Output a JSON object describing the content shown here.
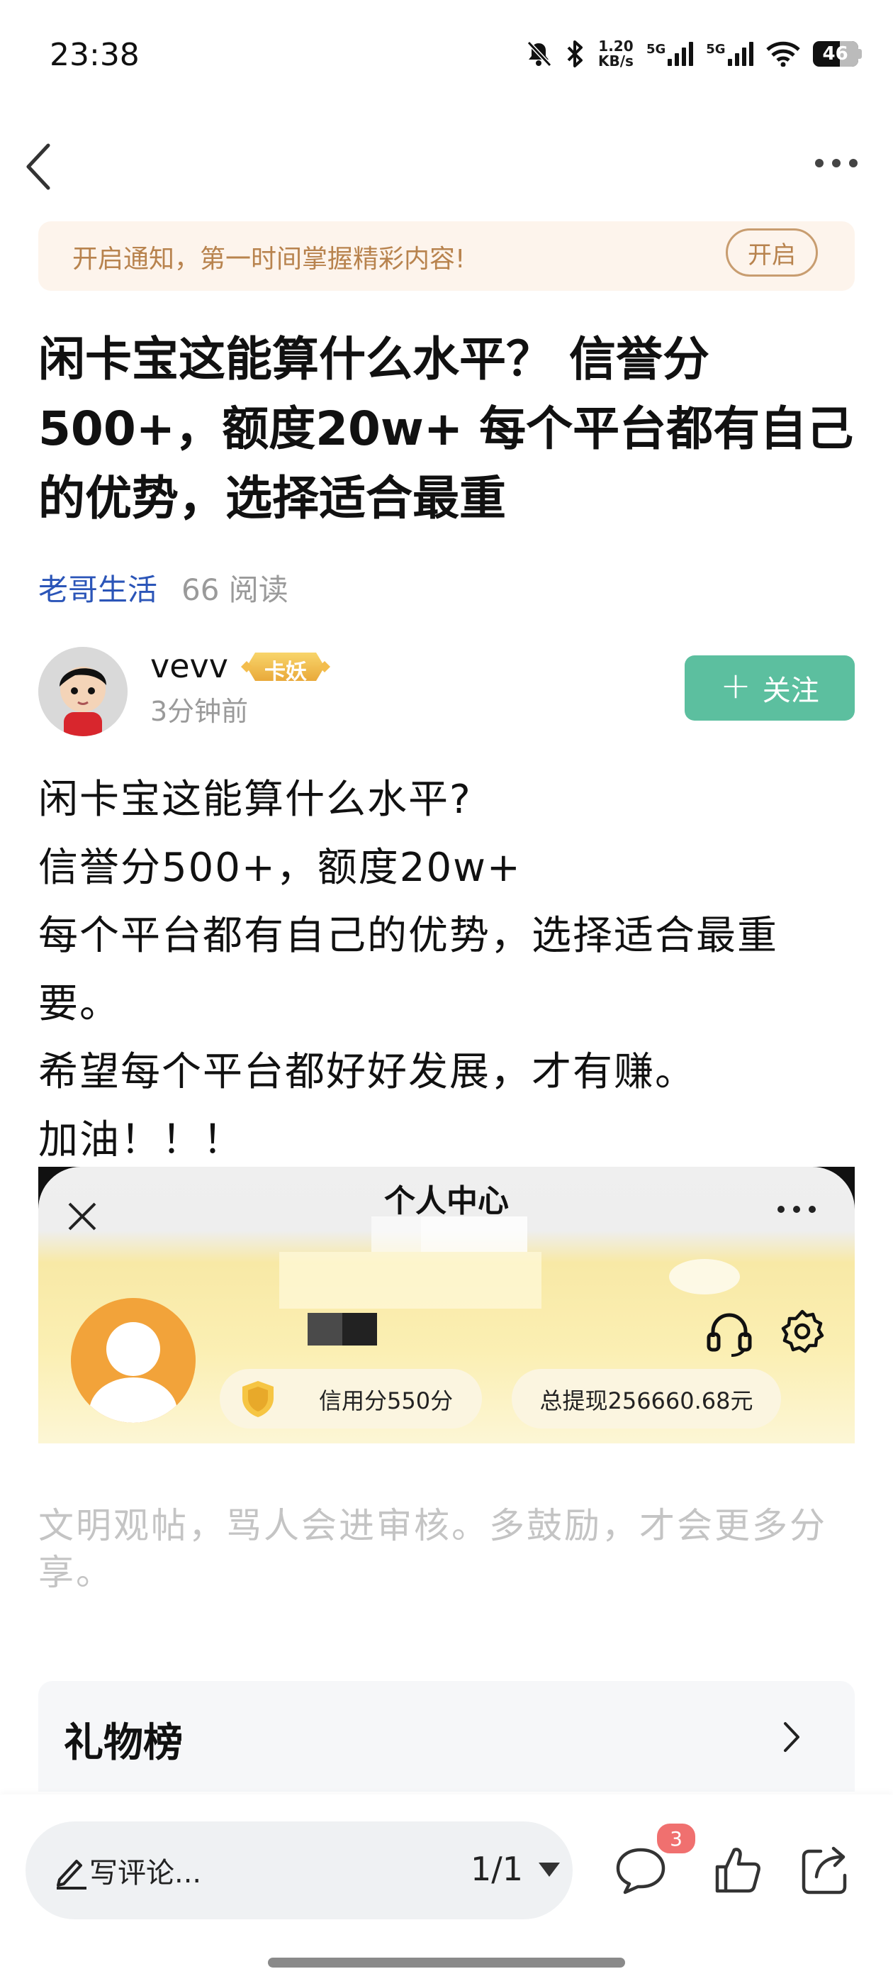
{
  "status_bar": {
    "time": "23:38",
    "net_speed_value": "1.20",
    "net_speed_unit": "KB/s",
    "sim1": "5G",
    "sim2": "5G",
    "battery": "46"
  },
  "nav": {
    "back_icon": "chevron-left-icon",
    "more_icon": "more-icon"
  },
  "notify": {
    "text": "开启通知，第一时间掌握精彩内容!",
    "button": "开启"
  },
  "post": {
    "title": "闲卡宝这能算什么水平？ 信誉分500+，额度20w+ 每个平台都有自己的优势，选择适合最重",
    "circle": "老哥生活",
    "reads": "66 阅读",
    "author": "vevv",
    "badge": "卡妖",
    "time": "3分钟前",
    "follow": "关注",
    "body": [
      "闲卡宝这能算什么水平?",
      "信誉分500+，额度20w+",
      "每个平台都有自己的优势，选择适合最重",
      "要。",
      "希望每个平台都好好发展，才有赚。",
      "加油！！！"
    ]
  },
  "embed": {
    "title": "个人中心",
    "credit": "信用分550分",
    "withdraw": "总提现256660.68元"
  },
  "comment_hint": "文明观帖，骂人会进审核。多鼓励，才会更多分享。",
  "gift": {
    "title": "礼物榜"
  },
  "bottom": {
    "placeholder": "写评论...",
    "page": "1/1",
    "comment_count": "3"
  },
  "colors": {
    "accent_green": "#5cbf9f",
    "link_blue": "#2b55b8",
    "notify_bg": "#fdf4ec",
    "notify_text": "#b8834e",
    "badge_red": "#f0706f"
  }
}
